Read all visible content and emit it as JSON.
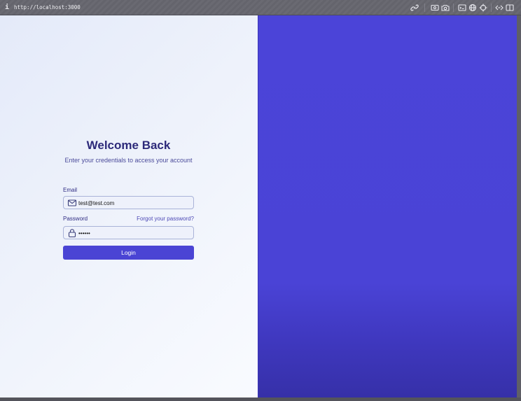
{
  "browser": {
    "url": "http://localhost:3000",
    "info_icon": "info-icon",
    "toolbar_icons": [
      "link-icon",
      "screenshot-icon",
      "camera-icon",
      "terminal-icon",
      "globe-icon",
      "crosshair-icon",
      "code-brackets-icon",
      "split-view-icon"
    ]
  },
  "login": {
    "title": "Welcome Back",
    "subtitle": "Enter your credentials to access your account",
    "email_label": "Email",
    "email_value": "test@test.com",
    "password_label": "Password",
    "forgot_link": "Forgot your password?",
    "password_value": "••••••",
    "login_button": "Login"
  },
  "colors": {
    "accent": "#4a44d4",
    "heading": "#2d2a7a",
    "right_panel": "#4b44d8"
  }
}
